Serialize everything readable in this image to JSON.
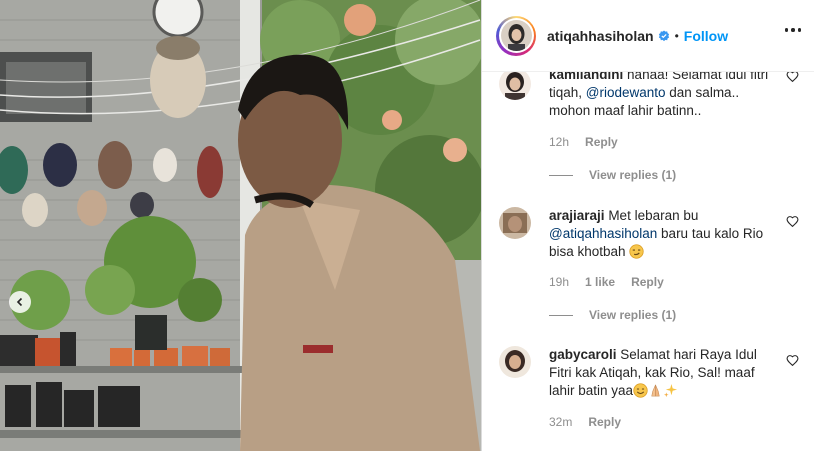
{
  "media": {
    "description_icon": "chevron-left-icon"
  },
  "header": {
    "username": "atiqahhasiholan",
    "separator": "•",
    "follow_label": "Follow",
    "verified_icon": "verified-badge-icon",
    "more_icon": "more-options-icon"
  },
  "comments": [
    {
      "username": "kamilandini",
      "parts": [
        "hahaa! Selamat idul fitri tiqah, ",
        "@riodewanto",
        " dan salma.. mohon maaf lahir batinn.."
      ],
      "time": "12h",
      "likes": "",
      "reply_label": "Reply",
      "view_replies": "View replies (1)"
    },
    {
      "username": "arajiaraji",
      "parts": [
        "Met lebaran bu ",
        "@atiqahhasiholan",
        " baru tau kalo Rio bisa khotbah "
      ],
      "time": "19h",
      "likes": "1 like",
      "reply_label": "Reply",
      "view_replies": "View replies (1)"
    },
    {
      "username": "gabycaroli",
      "parts": [
        "Selamat hari Raya Idul Fitri kak Atiqah, kak Rio, Sal! maaf lahir batin yaa"
      ],
      "time": "32m",
      "likes": "",
      "reply_label": "Reply",
      "view_replies": ""
    }
  ],
  "colors": {
    "link": "#0095f6",
    "mention": "#00376b",
    "muted": "#8e8e8e"
  }
}
